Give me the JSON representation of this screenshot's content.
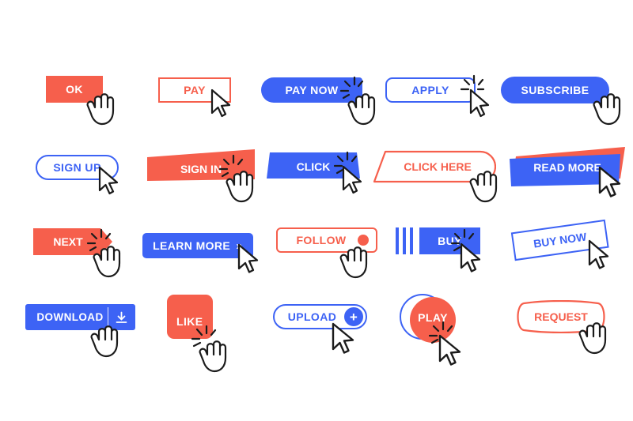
{
  "meta": {
    "title": "Button set with mouse cursor pointers",
    "background": "#ffffff",
    "colors": {
      "coral": "#f65f4c",
      "blue": "#3d63f5",
      "white": "#ffffff",
      "cursor_outline": "#1b1b1b"
    }
  },
  "rows": [
    {
      "index": 1,
      "buttons": [
        {
          "label": "OK",
          "shape": "rectangle",
          "style": "filled",
          "color": "#f65f4c",
          "text_color": "#ffffff",
          "cursor": "hand",
          "click_effect": false
        },
        {
          "label": "PAY",
          "shape": "rectangle",
          "style": "outlined",
          "color": "#f65f4c",
          "text_color": "#f65f4c",
          "cursor": "arrow",
          "click_effect": false
        },
        {
          "label": "PAY NOW",
          "shape": "rounded-left-pill",
          "style": "filled",
          "color": "#3d63f5",
          "text_color": "#ffffff",
          "cursor": "hand",
          "click_effect": true
        },
        {
          "label": "APPLY",
          "shape": "rounded-rect",
          "style": "outlined",
          "color": "#3d63f5",
          "text_color": "#3d63f5",
          "cursor": "arrow",
          "click_effect": true
        },
        {
          "label": "SUBSCRIBE",
          "shape": "pill",
          "style": "filled",
          "color": "#3d63f5",
          "text_color": "#ffffff",
          "cursor": "hand",
          "click_effect": false
        }
      ]
    },
    {
      "index": 2,
      "buttons": [
        {
          "label": "SIGN UP",
          "shape": "pill",
          "style": "outlined",
          "color": "#3d63f5",
          "text_color": "#3d63f5",
          "cursor": "arrow",
          "click_effect": false
        },
        {
          "label": "SIGN IN",
          "shape": "skewed-banner",
          "style": "filled",
          "color": "#f65f4c",
          "text_color": "#ffffff",
          "cursor": "hand",
          "click_effect": true
        },
        {
          "label": "CLICK",
          "shape": "trapezoid",
          "style": "filled",
          "color": "#3d63f5",
          "text_color": "#ffffff",
          "cursor": "arrow",
          "click_effect": true
        },
        {
          "label": "CLICK HERE",
          "shape": "slanted-pill",
          "style": "outlined",
          "color": "#f65f4c",
          "text_color": "#f65f4c",
          "cursor": "hand",
          "click_effect": false
        },
        {
          "label": "READ MORE",
          "shape": "layered-banner",
          "style": "filled",
          "color": "#3d63f5",
          "accent_color": "#f65f4c",
          "text_color": "#ffffff",
          "cursor": "arrow",
          "click_effect": false
        }
      ]
    },
    {
      "index": 3,
      "buttons": [
        {
          "label": "NEXT",
          "shape": "arrow-right",
          "style": "filled",
          "color": "#f65f4c",
          "text_color": "#ffffff",
          "cursor": "hand",
          "click_effect": true
        },
        {
          "label": "LEARN MORE",
          "shape": "rounded-rect",
          "style": "filled",
          "color": "#3d63f5",
          "text_color": "#ffffff",
          "cursor": "arrow",
          "click_effect": false,
          "icon": "double-chevron-right",
          "icon_glyph": "»"
        },
        {
          "label": "FOLLOW",
          "shape": "rounded-rect",
          "style": "outlined",
          "color": "#f65f4c",
          "text_color": "#f65f4c",
          "cursor": "hand",
          "click_effect": false,
          "icon": "dot"
        },
        {
          "label": "BUY",
          "shape": "rectangle-bars",
          "style": "filled",
          "color": "#3d63f5",
          "text_color": "#ffffff",
          "cursor": "arrow",
          "click_effect": true,
          "icon": "three-bars"
        },
        {
          "label": "BUY NOW",
          "shape": "rotated-rect",
          "style": "outlined",
          "color": "#3d63f5",
          "text_color": "#3d63f5",
          "cursor": "arrow",
          "click_effect": false,
          "rotation_deg": -8
        }
      ]
    },
    {
      "index": 4,
      "buttons": [
        {
          "label": "DOWNLOAD",
          "shape": "rect-split",
          "style": "filled",
          "color": "#3d63f5",
          "text_color": "#ffffff",
          "cursor": "hand",
          "click_effect": false,
          "icon": "download-icon"
        },
        {
          "label": "LIKE",
          "shape": "rounded-square",
          "style": "filled",
          "color": "#f65f4c",
          "text_color": "#ffffff",
          "cursor": "hand",
          "click_effect": true
        },
        {
          "label": "UPLOAD",
          "shape": "pill",
          "style": "outlined",
          "color": "#3d63f5",
          "text_color": "#3d63f5",
          "cursor": "arrow",
          "click_effect": false,
          "icon": "plus-circle-icon",
          "icon_glyph": "+"
        },
        {
          "label": "PLAY",
          "shape": "double-circle",
          "style": "filled",
          "color": "#f65f4c",
          "accent_color": "#3d63f5",
          "text_color": "#ffffff",
          "cursor": "arrow",
          "click_effect": true
        },
        {
          "label": "REQUEST",
          "shape": "wavy-rounded",
          "style": "outlined",
          "color": "#f65f4c",
          "text_color": "#f65f4c",
          "cursor": "hand",
          "click_effect": false
        }
      ]
    }
  ]
}
